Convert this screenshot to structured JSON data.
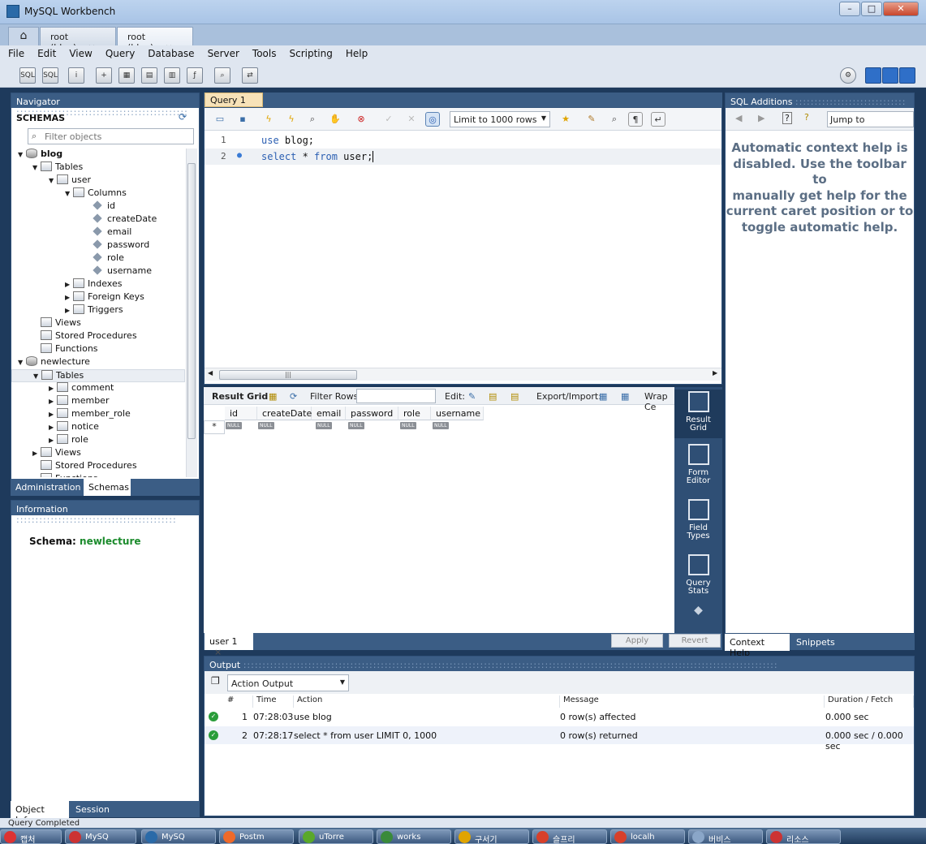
{
  "window": {
    "title": "MySQL Workbench"
  },
  "connection_tabs": [
    {
      "label": "root (blog)"
    },
    {
      "label": "root (blog)"
    }
  ],
  "menu": [
    "File",
    "Edit",
    "View",
    "Query",
    "Database",
    "Server",
    "Tools",
    "Scripting",
    "Help"
  ],
  "navigator": {
    "header": "Navigator",
    "schemas_label": "SCHEMAS",
    "filter_placeholder": "Filter objects",
    "tree": [
      {
        "label": "blog",
        "level": 0,
        "kind": "db",
        "expanded": true,
        "bold": true
      },
      {
        "label": "Tables",
        "level": 1,
        "kind": "folder",
        "expanded": true
      },
      {
        "label": "user",
        "level": 2,
        "kind": "table",
        "expanded": true
      },
      {
        "label": "Columns",
        "level": 3,
        "kind": "folder",
        "expanded": true
      },
      {
        "label": "id",
        "level": 4,
        "kind": "column"
      },
      {
        "label": "createDate",
        "level": 4,
        "kind": "column"
      },
      {
        "label": "email",
        "level": 4,
        "kind": "column"
      },
      {
        "label": "password",
        "level": 4,
        "kind": "column"
      },
      {
        "label": "role",
        "level": 4,
        "kind": "column"
      },
      {
        "label": "username",
        "level": 4,
        "kind": "column"
      },
      {
        "label": "Indexes",
        "level": 3,
        "kind": "folder",
        "expanded": false
      },
      {
        "label": "Foreign Keys",
        "level": 3,
        "kind": "folder",
        "expanded": false
      },
      {
        "label": "Triggers",
        "level": 3,
        "kind": "folder",
        "expanded": false
      },
      {
        "label": "Views",
        "level": 1,
        "kind": "folder"
      },
      {
        "label": "Stored Procedures",
        "level": 1,
        "kind": "folder"
      },
      {
        "label": "Functions",
        "level": 1,
        "kind": "folder"
      },
      {
        "label": "newlecture",
        "level": 0,
        "kind": "db",
        "expanded": true
      },
      {
        "label": "Tables",
        "level": 1,
        "kind": "folder",
        "expanded": true,
        "selected": true
      },
      {
        "label": "comment",
        "level": 2,
        "kind": "table",
        "expanded": false
      },
      {
        "label": "member",
        "level": 2,
        "kind": "table",
        "expanded": false
      },
      {
        "label": "member_role",
        "level": 2,
        "kind": "table",
        "expanded": false
      },
      {
        "label": "notice",
        "level": 2,
        "kind": "table",
        "expanded": false
      },
      {
        "label": "role",
        "level": 2,
        "kind": "table",
        "expanded": false
      },
      {
        "label": "Views",
        "level": 1,
        "kind": "folder",
        "expanded": false
      },
      {
        "label": "Stored Procedures",
        "level": 1,
        "kind": "folder"
      },
      {
        "label": "Functions",
        "level": 1,
        "kind": "folder"
      }
    ],
    "tabs": [
      "Administration",
      "Schemas"
    ]
  },
  "information": {
    "header": "Information",
    "schema_label": "Schema:",
    "schema_value": "newlecture",
    "tabs": [
      "Object Info",
      "Session"
    ]
  },
  "query": {
    "tab_label": "Query 1",
    "limit_label": "Limit to 1000 rows",
    "lines": [
      {
        "num": "1",
        "keyword": "use",
        "rest": " blog;"
      },
      {
        "num": "2",
        "keyword": "select",
        "rest": " * ",
        "kw2": "from",
        "rest2": " user;"
      }
    ]
  },
  "result": {
    "grid_label": "Result Grid",
    "filter_rows_label": "Filter Rows:",
    "edit_label": "Edit:",
    "export_label": "Export/Import:",
    "wrap_label": "Wrap Ce",
    "columns": [
      "id",
      "createDate",
      "email",
      "password",
      "role",
      "username"
    ],
    "null_text": "NULL",
    "row_marker": "*",
    "tab_label": "user 1",
    "apply_label": "Apply",
    "revert_label": "Revert",
    "side_tools": [
      {
        "l1": "Result",
        "l2": "Grid"
      },
      {
        "l1": "Form",
        "l2": "Editor"
      },
      {
        "l1": "Field",
        "l2": "Types"
      },
      {
        "l1": "Query",
        "l2": "Stats"
      }
    ]
  },
  "sql_additions": {
    "header": "SQL Additions",
    "jump_to": "Jump to",
    "help_lines": [
      "Automatic context help is",
      "disabled. Use the toolbar to",
      "manually get help for the",
      "current caret position or to",
      "toggle automatic help."
    ],
    "tabs": [
      "Context Help",
      "Snippets"
    ]
  },
  "output": {
    "header": "Output",
    "selector": "Action Output",
    "columns": [
      "#",
      "Time",
      "Action",
      "Message",
      "Duration / Fetch"
    ],
    "rows": [
      {
        "num": "1",
        "time": "07:28:03",
        "action": "use blog",
        "message": "0 row(s) affected",
        "duration": "0.000 sec"
      },
      {
        "num": "2",
        "time": "07:28:17",
        "action": "select * from user LIMIT 0, 1000",
        "message": "0 row(s) returned",
        "duration": "0.000 sec / 0.000 sec"
      }
    ]
  },
  "status": {
    "text": "Query Completed"
  },
  "taskbar": [
    "캡처",
    "MySQ",
    "Postm",
    "uTorre",
    "works",
    "구서기",
    "슬프리",
    "localh",
    "버비스",
    "리소스"
  ],
  "colors": {
    "panel_header": "#3b5d85",
    "query_tab": "#f7e2b8",
    "schema_value": "#1b8b2c",
    "ok": "#2a9d3a",
    "keyword": "#2b5fb2"
  }
}
